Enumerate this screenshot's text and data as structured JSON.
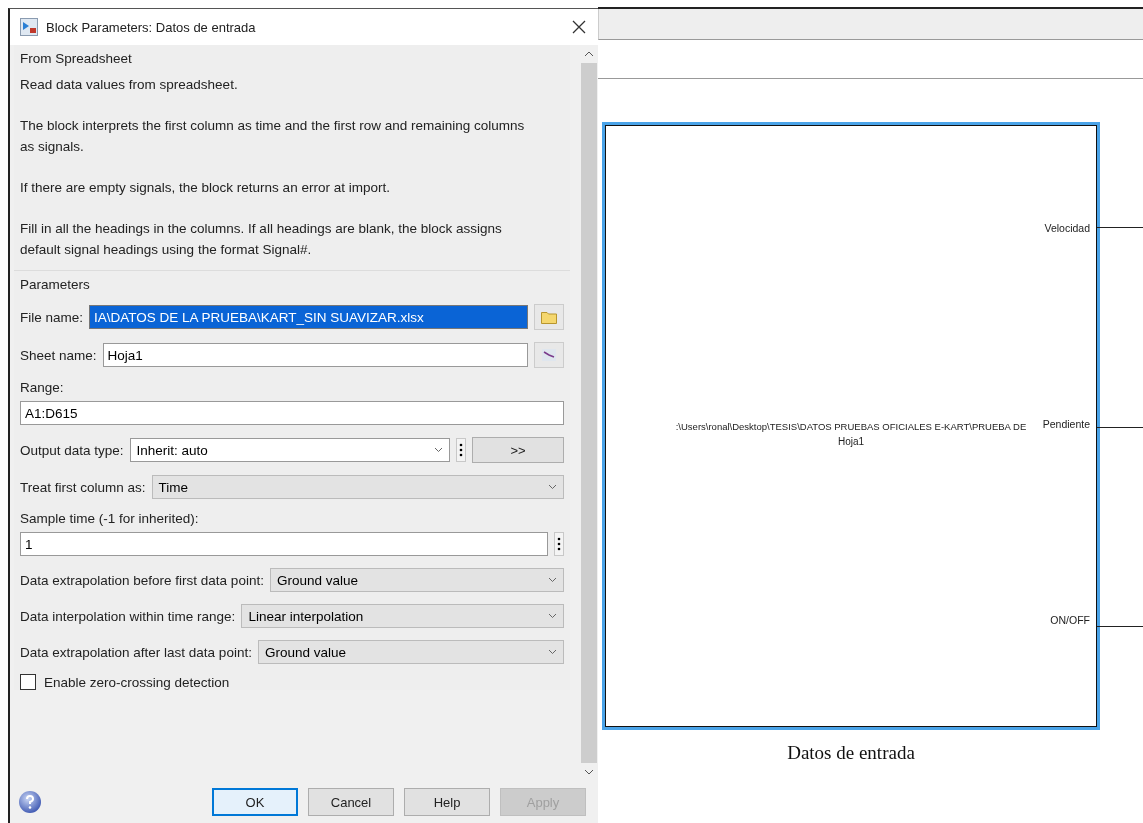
{
  "dialog": {
    "title": "Block Parameters: Datos de entrada",
    "block_type": "From Spreadsheet",
    "description": [
      "Read data values from spreadsheet.",
      "The block interprets the first column as time and the first row and remaining columns as signals.",
      "If there are empty signals, the block returns an error at import.",
      "Fill in all the headings in the columns. If all headings are blank, the block assigns default signal headings using the format Signal#."
    ],
    "section": "Parameters",
    "file_name": {
      "label": "File name:",
      "value": "IA\\DATOS DE LA PRUEBA\\KART_SIN SUAVIZAR.xlsx",
      "selected": true
    },
    "sheet_name": {
      "label": "Sheet name:",
      "value": "Hoja1"
    },
    "range": {
      "label": "Range:",
      "value": "A1:D615"
    },
    "output_data_type": {
      "label": "Output data type:",
      "value": "Inherit: auto",
      "button": ">>"
    },
    "treat_first_column": {
      "label": "Treat first column as:",
      "value": "Time"
    },
    "sample_time": {
      "label": "Sample time (-1 for inherited):",
      "value": "1"
    },
    "dropdowns": [
      {
        "label": "Data extrapolation before first data point:",
        "value": "Ground value"
      },
      {
        "label": "Data interpolation within time range:",
        "value": "Linear interpolation"
      },
      {
        "label": "Data extrapolation after last data point:",
        "value": "Ground value"
      }
    ],
    "zero_crossing": {
      "label": "Enable zero-crossing detection",
      "checked": false
    },
    "buttons": [
      {
        "label": "OK",
        "focused": true,
        "disabled": false
      },
      {
        "label": "Cancel",
        "focused": false,
        "disabled": false
      },
      {
        "label": "Help",
        "focused": false,
        "disabled": false
      },
      {
        "label": "Apply",
        "focused": false,
        "disabled": true
      }
    ]
  },
  "canvas": {
    "block": {
      "selected": true,
      "path_text": ":\\Users\\ronal\\Desktop\\TESIS\\DATOS PRUEBAS OFICIALES E-KART\\PRUEBA DE",
      "sheet": "Hoja1",
      "ports": [
        "Velocidad",
        "Pendiente",
        "ON/OFF"
      ],
      "caption": "Datos de entrada"
    }
  }
}
